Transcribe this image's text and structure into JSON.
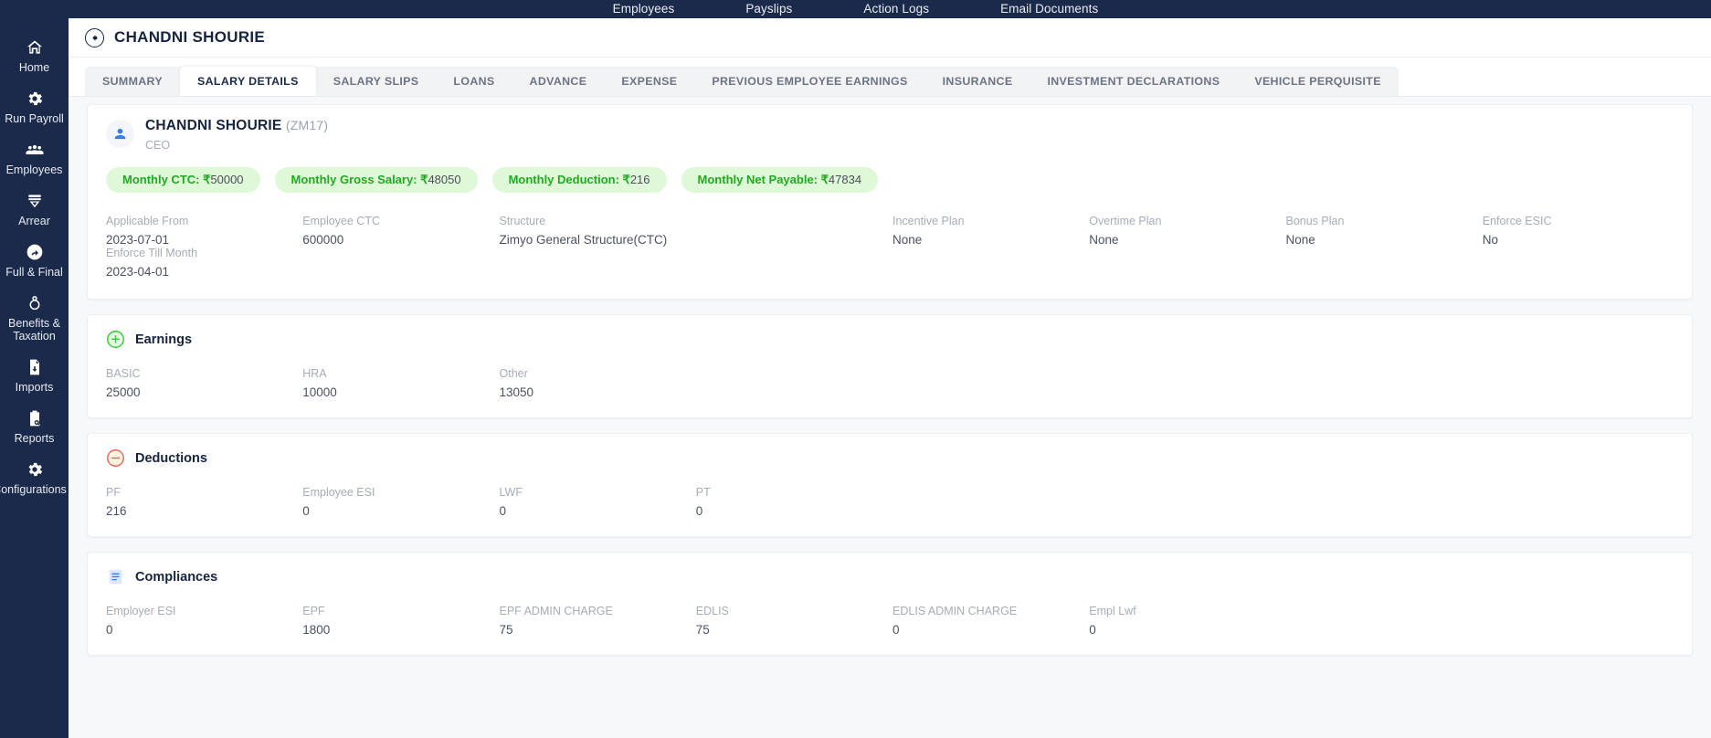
{
  "topnav": {
    "links": [
      {
        "label": "Employees"
      },
      {
        "label": "Payslips"
      },
      {
        "label": "Action Logs"
      },
      {
        "label": "Email Documents"
      }
    ]
  },
  "sidebar": {
    "items": [
      {
        "label": "Home",
        "icon": "home-icon"
      },
      {
        "label": "Run Payroll",
        "icon": "gear-icon"
      },
      {
        "label": "Employees",
        "icon": "people-icon"
      },
      {
        "label": "Arrear",
        "icon": "money-icon"
      },
      {
        "label": "Full & Final",
        "icon": "refresh-icon"
      },
      {
        "label": "Benefits & Taxation",
        "icon": "piggy-icon"
      },
      {
        "label": "Imports",
        "icon": "import-file-icon"
      },
      {
        "label": "Reports",
        "icon": "report-search-icon"
      },
      {
        "label": "Configurations",
        "icon": "settings-gear-icon"
      }
    ]
  },
  "header": {
    "back_icon": "back-arrow-icon",
    "title": "CHANDNI SHOURIE"
  },
  "tabs": {
    "active": "SALARY DETAILS",
    "items": [
      {
        "label": "SUMMARY"
      },
      {
        "label": "SALARY DETAILS"
      },
      {
        "label": "SALARY SLIPS"
      },
      {
        "label": "LOANS"
      },
      {
        "label": "ADVANCE"
      },
      {
        "label": "EXPENSE"
      },
      {
        "label": "PREVIOUS EMPLOYEE EARNINGS"
      },
      {
        "label": "INSURANCE"
      },
      {
        "label": "INVESTMENT DECLARATIONS"
      },
      {
        "label": "VEHICLE PERQUISITE"
      }
    ]
  },
  "employee": {
    "avatar_icon": "user-avatar-icon",
    "name": "CHANDNI SHOURIE",
    "code": "(ZM17)",
    "role": "CEO",
    "badges": [
      {
        "label": "Monthly CTC:",
        "currency": "₹",
        "value": "50000"
      },
      {
        "label": "Monthly Gross Salary:",
        "currency": "₹",
        "value": "48050"
      },
      {
        "label": "Monthly Deduction:",
        "currency": "₹",
        "value": "216"
      },
      {
        "label": "Monthly Net Payable:",
        "currency": "₹",
        "value": "47834"
      }
    ],
    "meta": [
      {
        "label": "Applicable From",
        "value": "2023-07-01"
      },
      {
        "label": "Employee CTC",
        "value": "600000"
      },
      {
        "label": "Structure",
        "value": "Zimyo General Structure(CTC)"
      },
      {
        "label": "Incentive Plan",
        "value": "None"
      },
      {
        "label": "Overtime Plan",
        "value": "None"
      },
      {
        "label": "Bonus Plan",
        "value": "None"
      },
      {
        "label": "Enforce ESIC",
        "value": "No"
      },
      {
        "label": "Enforce Till Month",
        "value": "2023-04-01"
      }
    ]
  },
  "earnings": {
    "icon": "plus-circle-icon",
    "title": "Earnings",
    "rows": [
      {
        "label": "BASIC",
        "value": "25000"
      },
      {
        "label": "HRA",
        "value": "10000"
      },
      {
        "label": "Other",
        "value": "13050"
      }
    ]
  },
  "deductions": {
    "icon": "minus-circle-icon",
    "title": "Deductions",
    "rows": [
      {
        "label": "PF",
        "value": "216"
      },
      {
        "label": "Employee ESI",
        "value": "0"
      },
      {
        "label": "LWF",
        "value": "0"
      },
      {
        "label": "PT",
        "value": "0"
      }
    ]
  },
  "compliances": {
    "icon": "document-icon",
    "title": "Compliances",
    "rows": [
      {
        "label": "Employer ESI",
        "value": "0"
      },
      {
        "label": "EPF",
        "value": "1800"
      },
      {
        "label": "EPF ADMIN CHARGE",
        "value": "75"
      },
      {
        "label": "EDLIS",
        "value": "75"
      },
      {
        "label": "EDLIS ADMIN CHARGE",
        "value": "0"
      },
      {
        "label": "Empl Lwf",
        "value": "0"
      }
    ]
  },
  "colors": {
    "sidebar_bg": "#1b2a4a",
    "badge_bg": "#dff8d8",
    "badge_text": "#1faa1f",
    "accent": "#2f80ed",
    "page_bg": "#f7f8fa"
  }
}
